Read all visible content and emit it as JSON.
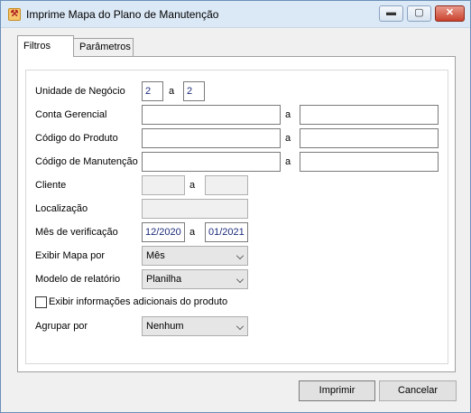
{
  "window": {
    "title": "Imprime Mapa do Plano de Manutenção",
    "minimize": "▬",
    "maximize": "▢",
    "close": "✕",
    "icon": "app-icon"
  },
  "tabs": [
    {
      "label": "Filtros"
    },
    {
      "label": "Parâmetros"
    }
  ],
  "form": {
    "unidade": {
      "label": "Unidade de Negócio",
      "from": "2",
      "sep": "a",
      "to": "2"
    },
    "conta": {
      "label": "Conta Gerencial",
      "from": "",
      "sep": "a",
      "to": ""
    },
    "produto": {
      "label": "Código do Produto",
      "from": "",
      "sep": "a",
      "to": ""
    },
    "manutencao": {
      "label": "Código de Manutenção",
      "from": "",
      "sep": "a",
      "to": ""
    },
    "cliente": {
      "label": "Cliente",
      "from": "",
      "sep": "a",
      "to": ""
    },
    "localizacao": {
      "label": "Localização",
      "value": ""
    },
    "mes": {
      "label": "Mês de verificação",
      "from": "12/2020",
      "sep": "a",
      "to": "01/2021"
    },
    "exibir_mapa": {
      "label": "Exibir Mapa por",
      "value": "Mês"
    },
    "modelo": {
      "label": "Modelo de relatório",
      "value": "Planilha"
    },
    "info_adicional": {
      "label": "Exibir informações adicionais do produto",
      "checked": false
    },
    "agrupar": {
      "label": "Agrupar por",
      "value": "Nenhum"
    }
  },
  "buttons": {
    "imprimir": "Imprimir",
    "cancelar": "Cancelar"
  }
}
